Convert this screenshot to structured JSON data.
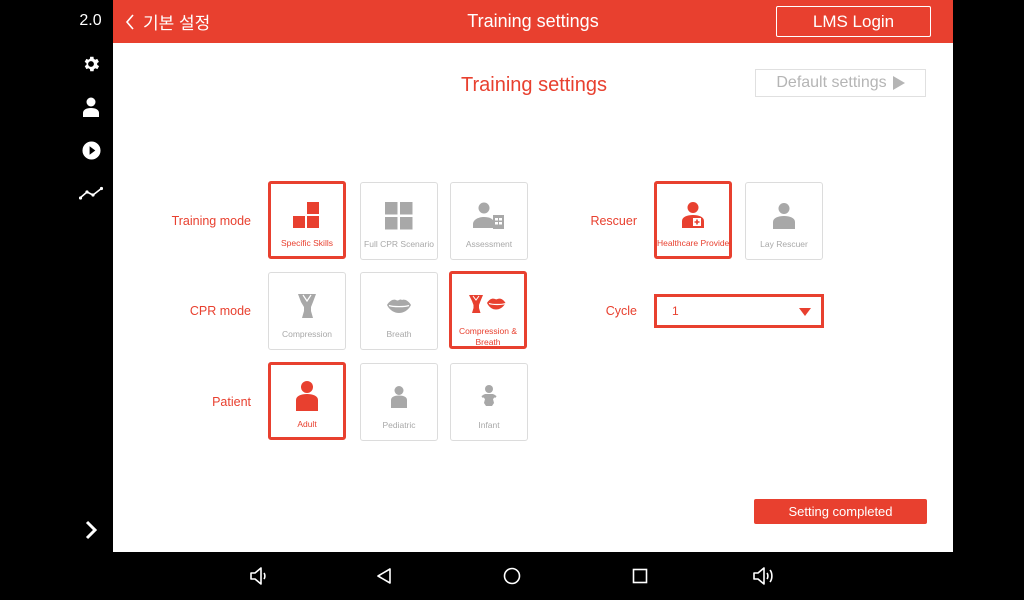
{
  "rail": {
    "version": "2.0"
  },
  "topbar": {
    "back_label": "기본 설정",
    "title": "Training settings",
    "lms_label": "LMS Login"
  },
  "panel": {
    "title": "Training settings",
    "default_label": "Default settings"
  },
  "training_mode": {
    "label": "Training mode",
    "options": [
      "Specific Skills",
      "Full CPR Scenario",
      "Assessment"
    ],
    "selected": "Specific Skills"
  },
  "cpr_mode": {
    "label": "CPR mode",
    "options": [
      "Compression",
      "Breath",
      "Compression & Breath"
    ],
    "selected": "Compression & Breath"
  },
  "patient": {
    "label": "Patient",
    "options": [
      "Adult",
      "Pediatric",
      "Infant"
    ],
    "selected": "Adult"
  },
  "rescuer": {
    "label": "Rescuer",
    "options": [
      "Healthcare Provider",
      "Lay Rescuer"
    ],
    "selected": "Healthcare Provider"
  },
  "cycle": {
    "label": "Cycle",
    "value": "1"
  },
  "actions": {
    "complete_label": "Setting completed"
  },
  "colors": {
    "accent": "#e8402f",
    "inactive": "#a8a8a8"
  }
}
